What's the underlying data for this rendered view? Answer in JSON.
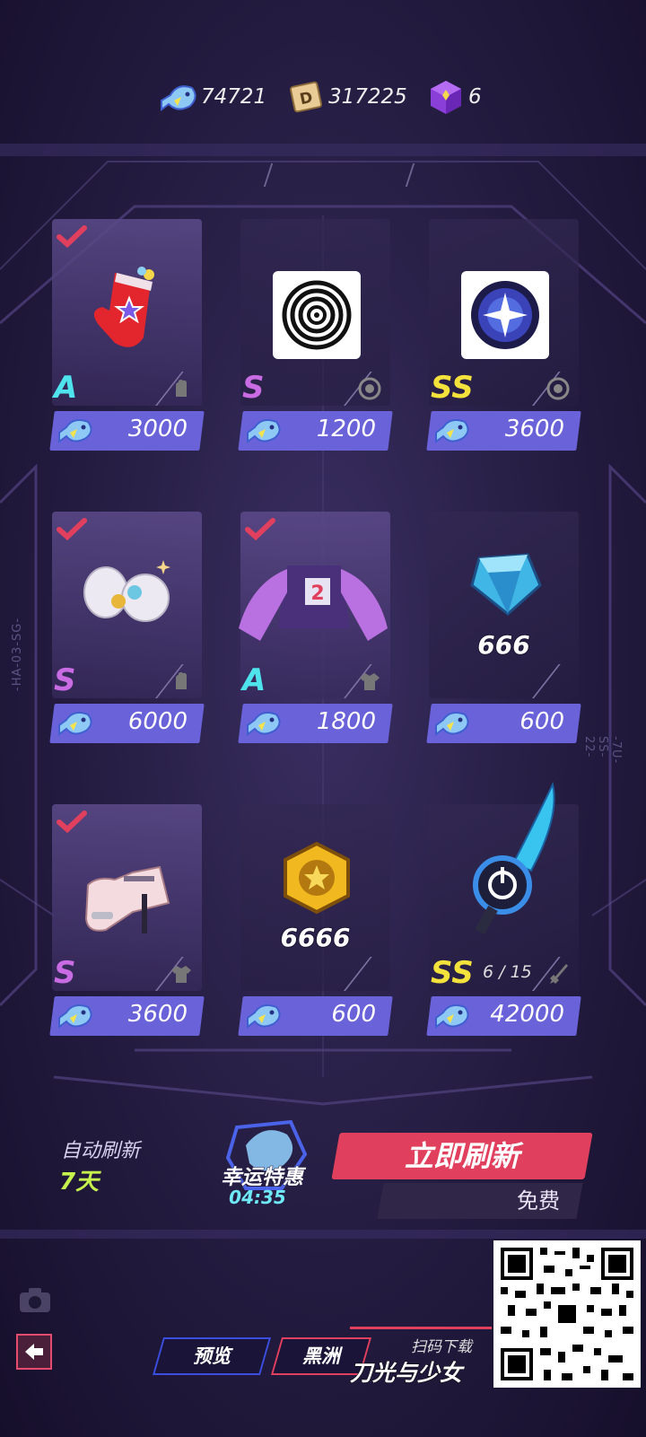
{
  "currencies": [
    {
      "name": "fish-coin",
      "icon": "fish-coin-icon",
      "value": "74721"
    },
    {
      "name": "d-ticket",
      "icon": "d-ticket-icon",
      "value": "317225"
    },
    {
      "name": "purple-cube",
      "icon": "purple-cube-icon",
      "value": "6"
    }
  ],
  "shop": {
    "items": [
      {
        "rank": "A",
        "type": "glove",
        "price": "3000",
        "purchased": true,
        "image": "red-star-mitten"
      },
      {
        "rank": "S",
        "type": "target",
        "price": "1200",
        "purchased": false,
        "image": "concentric-rings-icon"
      },
      {
        "rank": "SS",
        "type": "target",
        "price": "3600",
        "purchased": false,
        "image": "star-orb-icon"
      },
      {
        "rank": "S",
        "type": "glove",
        "price": "6000",
        "purchased": true,
        "image": "white-gauntlets"
      },
      {
        "rank": "A",
        "type": "shirt",
        "price": "1800",
        "purchased": true,
        "image": "purple-jacket"
      },
      {
        "rank": "",
        "type": "",
        "price": "600",
        "purchased": false,
        "image": "blue-diamond",
        "amount": "666"
      },
      {
        "rank": "S",
        "type": "shirt",
        "price": "3600",
        "purchased": true,
        "image": "pink-arm-outfit"
      },
      {
        "rank": "",
        "type": "",
        "price": "600",
        "purchased": false,
        "image": "gold-star-coin",
        "amount": "6666"
      },
      {
        "rank": "SS",
        "type": "blade",
        "price": "42000",
        "purchased": false,
        "image": "nova-blade",
        "progress": "6 / 15"
      }
    ]
  },
  "side_labels": {
    "left": "-HA-03-SG-",
    "right": "-7U-SS-22-"
  },
  "auto_refresh": {
    "label": "自动刷新",
    "value": "7天"
  },
  "lucky_deal": {
    "title": "幸运特惠",
    "timer": "04:35"
  },
  "refresh_button": {
    "label": "立即刷新",
    "cost": "免费"
  },
  "tabs": [
    {
      "label": "预览"
    },
    {
      "label": "黑洲"
    }
  ],
  "ad": {
    "scan_label": "扫码下载",
    "game_name": "刀光与少女"
  },
  "colors": {
    "price_bar": "#6a62d8",
    "rank_A": "#4fe3ee",
    "rank_S": "#c96ce4",
    "rank_SS": "#f4e23c",
    "refresh": "#e0405d"
  }
}
